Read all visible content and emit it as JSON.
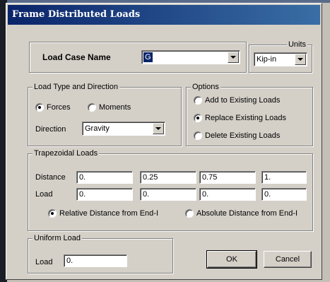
{
  "window": {
    "title": "Frame Distributed Loads"
  },
  "load_case": {
    "label": "Load Case Name",
    "value": "G"
  },
  "units": {
    "legend": "Units",
    "value": "Kip-in"
  },
  "load_type": {
    "legend": "Load Type and Direction",
    "forces_label": "Forces",
    "moments_label": "Moments",
    "selected": "Forces",
    "direction_label": "Direction",
    "direction_value": "Gravity"
  },
  "options": {
    "legend": "Options",
    "items": [
      "Add to Existing Loads",
      "Replace Existing Loads",
      "Delete Existing Loads"
    ],
    "selected": "Replace Existing Loads"
  },
  "trapezoidal": {
    "legend": "Trapezoidal Loads",
    "distance_label": "Distance",
    "load_label": "Load",
    "distances": [
      "0.",
      "0.25",
      "0.75",
      "1."
    ],
    "loads": [
      "0.",
      "0.",
      "0.",
      "0."
    ],
    "relative_label": "Relative Distance from End-I",
    "absolute_label": "Absolute Distance from End-I",
    "selected": "Relative"
  },
  "uniform": {
    "legend": "Uniform Load",
    "load_label": "Load",
    "value": "0."
  },
  "buttons": {
    "ok": "OK",
    "cancel": "Cancel"
  },
  "colors": {
    "title_start": "#0a246a",
    "title_end": "#3a6ea5",
    "face": "#d4d0c8"
  }
}
